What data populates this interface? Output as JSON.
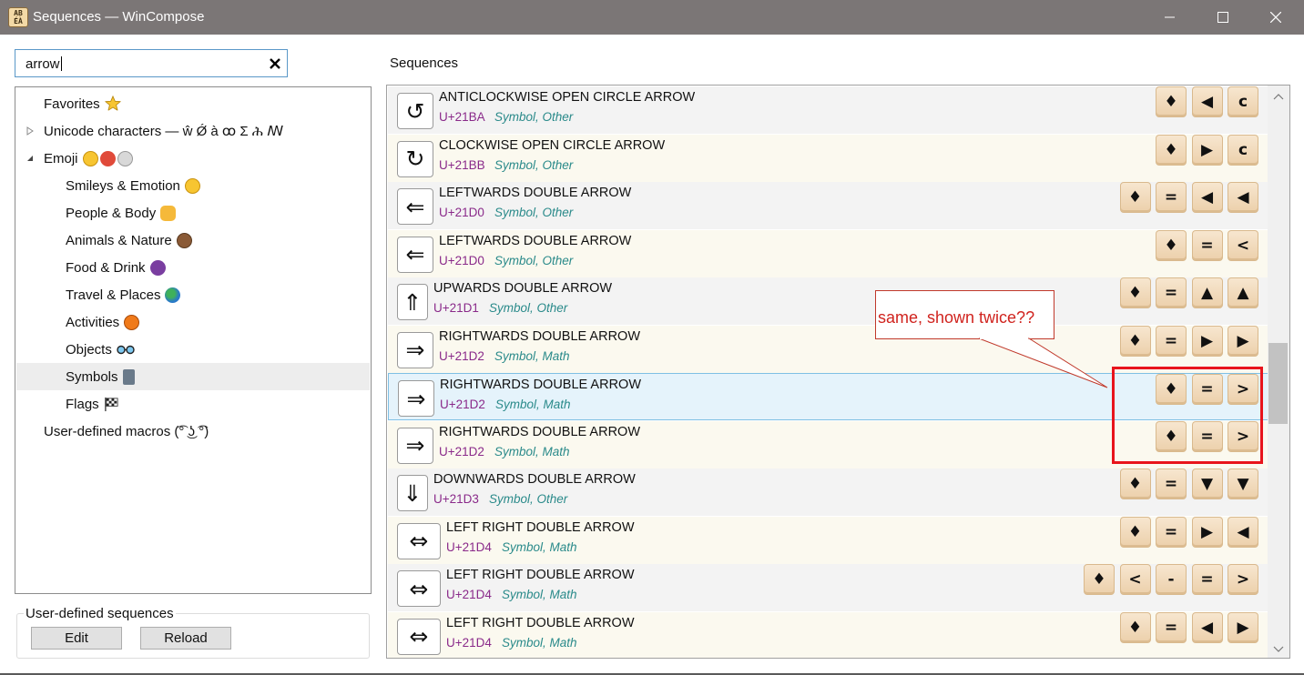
{
  "window": {
    "title": "Sequences — WinCompose",
    "app_icon_text": "AB ÉÀ"
  },
  "search": {
    "value": "arrow",
    "clear_icon": "close-icon"
  },
  "tree": {
    "items": [
      {
        "label": "Favorites",
        "icon": "star-icon"
      },
      {
        "label": "Unicode characters — ŵ Ǿ à ꝏ Σ ሕ ꟿ"
      },
      {
        "label": "Emoji"
      },
      {
        "label": "Smileys & Emotion"
      },
      {
        "label": "People & Body"
      },
      {
        "label": "Animals & Nature"
      },
      {
        "label": "Food & Drink"
      },
      {
        "label": "Travel & Places"
      },
      {
        "label": "Activities"
      },
      {
        "label": "Objects"
      },
      {
        "label": "Symbols"
      },
      {
        "label": "Flags"
      },
      {
        "label": "User-defined macros (͡° ͜ʖ ͡°)"
      }
    ],
    "selected": "Symbols"
  },
  "user_sequences": {
    "group_label": "User-defined sequences",
    "edit_label": "Edit",
    "reload_label": "Reload"
  },
  "sequences": {
    "header": "Sequences",
    "rows": [
      {
        "glyph": "↺",
        "name": "ANTICLOCKWISE OPEN CIRCLE ARROW",
        "code": "U+21BA",
        "category": "Symbol, Other",
        "keys": [
          "♦",
          "◀",
          "c"
        ]
      },
      {
        "glyph": "↻",
        "name": "CLOCKWISE OPEN CIRCLE ARROW",
        "code": "U+21BB",
        "category": "Symbol, Other",
        "keys": [
          "♦",
          "▶",
          "c"
        ]
      },
      {
        "glyph": "⇐",
        "name": "LEFTWARDS DOUBLE ARROW",
        "code": "U+21D0",
        "category": "Symbol, Other",
        "keys": [
          "♦",
          "=",
          "◀",
          "◀"
        ]
      },
      {
        "glyph": "⇐",
        "name": "LEFTWARDS DOUBLE ARROW",
        "code": "U+21D0",
        "category": "Symbol, Other",
        "keys": [
          "♦",
          "=",
          "<"
        ]
      },
      {
        "glyph": "⇑",
        "name": "UPWARDS DOUBLE ARROW",
        "code": "U+21D1",
        "category": "Symbol, Other",
        "keys": [
          "♦",
          "=",
          "▲",
          "▲"
        ]
      },
      {
        "glyph": "⇒",
        "name": "RIGHTWARDS DOUBLE ARROW",
        "code": "U+21D2",
        "category": "Symbol, Math",
        "keys": [
          "♦",
          "=",
          "▶",
          "▶"
        ]
      },
      {
        "glyph": "⇒",
        "name": "RIGHTWARDS DOUBLE ARROW",
        "code": "U+21D2",
        "category": "Symbol, Math",
        "keys": [
          "♦",
          "=",
          ">"
        ]
      },
      {
        "glyph": "⇒",
        "name": "RIGHTWARDS DOUBLE ARROW",
        "code": "U+21D2",
        "category": "Symbol, Math",
        "keys": [
          "♦",
          "=",
          ">"
        ]
      },
      {
        "glyph": "⇓",
        "name": "DOWNWARDS DOUBLE ARROW",
        "code": "U+21D3",
        "category": "Symbol, Other",
        "keys": [
          "♦",
          "=",
          "▼",
          "▼"
        ]
      },
      {
        "glyph": "⇔",
        "name": "LEFT RIGHT DOUBLE ARROW",
        "code": "U+21D4",
        "category": "Symbol, Math",
        "keys": [
          "♦",
          "=",
          "▶",
          "◀"
        ]
      },
      {
        "glyph": "⇔",
        "name": "LEFT RIGHT DOUBLE ARROW",
        "code": "U+21D4",
        "category": "Symbol, Math",
        "keys": [
          "♦",
          "<",
          "-",
          "=",
          ">"
        ]
      },
      {
        "glyph": "⇔",
        "name": "LEFT RIGHT DOUBLE ARROW",
        "code": "U+21D4",
        "category": "Symbol, Math",
        "keys": [
          "♦",
          "=",
          "◀",
          "▶"
        ]
      }
    ],
    "selected_index": 6
  },
  "annotation": {
    "text": "same, shown twice??",
    "color": "#e8141c"
  }
}
